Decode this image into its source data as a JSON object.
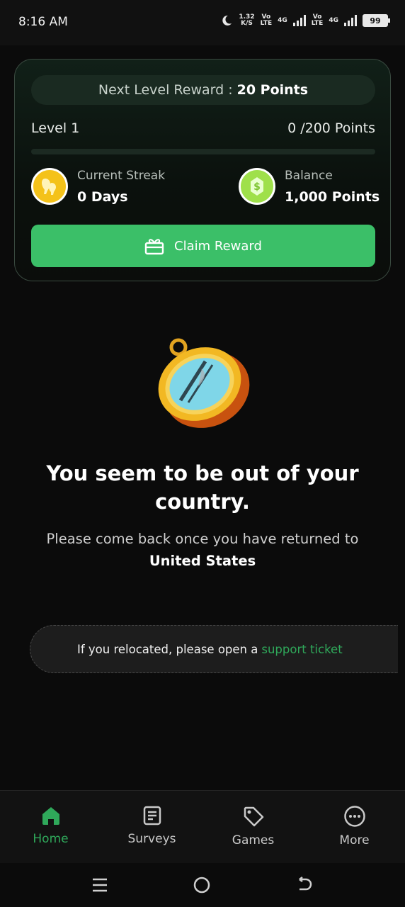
{
  "status_bar": {
    "time": "8:16 AM",
    "net_speed_value": "1.32",
    "net_speed_unit": "K/S",
    "sim1_label_top": "Vo",
    "sim1_label_bottom": "LTE",
    "sim1_net": "4G",
    "sim2_label_top": "Vo",
    "sim2_label_bottom": "LTE",
    "sim2_net": "4G",
    "battery": "99"
  },
  "reward_card": {
    "next_reward_prefix": "Next Level Reward :",
    "next_reward_value": "20 Points",
    "level_label": "Level 1",
    "level_points": "0 /200 Points",
    "progress_fraction": 0,
    "streak_label": "Current Streak",
    "streak_value": "0 Days",
    "balance_label": "Balance",
    "balance_value": "1,000 Points",
    "claim_button_label": "Claim Reward"
  },
  "notice": {
    "headline": "You seem to be out of your country.",
    "subtext": "Please come back once you have returned to",
    "country": "United States",
    "relocate_text": "If you relocated, please open a",
    "relocate_link": "support ticket"
  },
  "bottom_nav": {
    "items": [
      {
        "label": "Home",
        "icon": "home-icon",
        "active": true
      },
      {
        "label": "Surveys",
        "icon": "document-icon",
        "active": false
      },
      {
        "label": "Games",
        "icon": "tag-icon",
        "active": false
      },
      {
        "label": "More",
        "icon": "more-icon",
        "active": false
      }
    ]
  },
  "colors": {
    "accent_green": "#3bbf68",
    "link_green": "#2fa85a",
    "streak_yellow": "#f4c21a",
    "balance_lime": "#9fe04a"
  }
}
